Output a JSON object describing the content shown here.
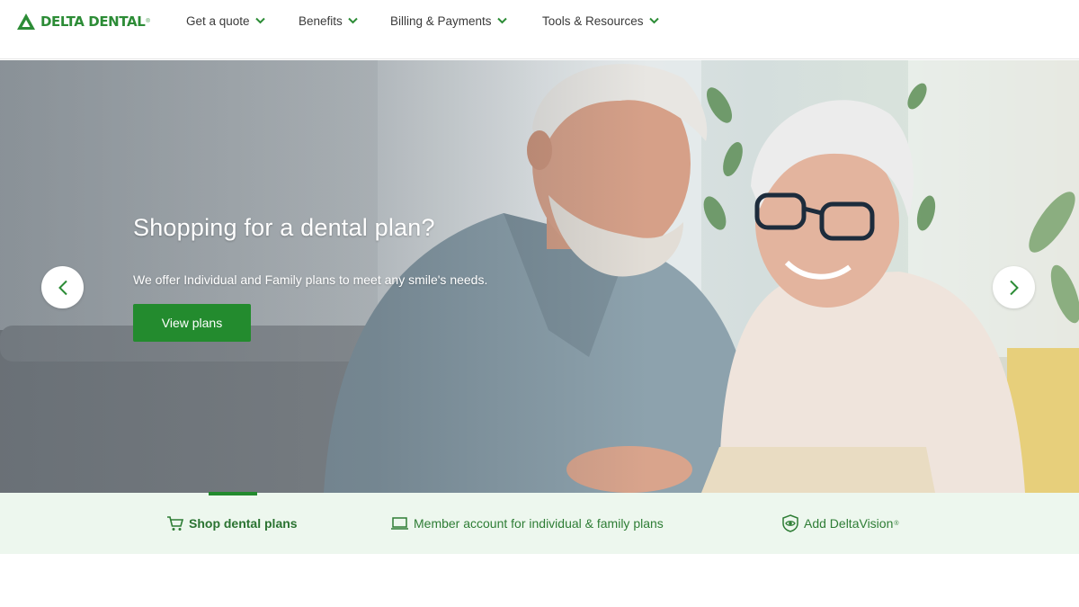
{
  "brand": {
    "name": "DELTA DENTAL",
    "trademark": "®",
    "color": "#2c8c36"
  },
  "nav": {
    "items": [
      {
        "label": "Get a quote",
        "icon": "chevron-down-icon"
      },
      {
        "label": "Benefits",
        "icon": "chevron-down-icon"
      },
      {
        "label": "Billing & Payments",
        "icon": "chevron-down-icon"
      },
      {
        "label": "Tools & Resources",
        "icon": "chevron-down-icon"
      }
    ]
  },
  "hero": {
    "title": "Shopping for a dental plan?",
    "subtitle": "We offer Individual and Family plans to meet any smile's needs.",
    "cta_label": "View plans",
    "prev_icon": "chevron-left-icon",
    "next_icon": "chevron-right-icon",
    "accent": "#238b2e"
  },
  "tabs": {
    "items": [
      {
        "label": "Shop dental plans",
        "icon": "cart-icon",
        "active": true
      },
      {
        "label": "Member account for individual & family plans",
        "icon": "laptop-icon",
        "active": false
      },
      {
        "label": "Add DeltaVision",
        "trademark": "®",
        "icon": "eye-shield-icon",
        "active": false
      }
    ],
    "background": "#edf7ee"
  }
}
